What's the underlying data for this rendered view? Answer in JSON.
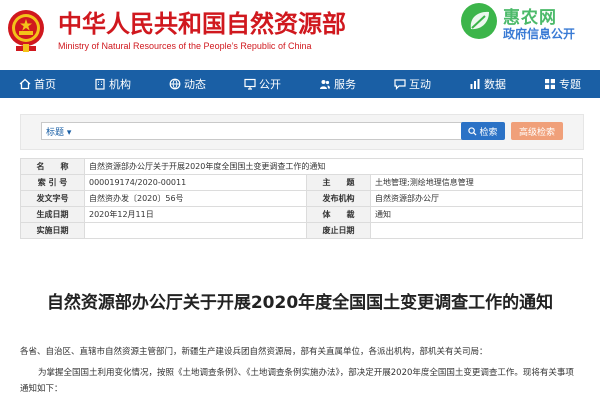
{
  "header": {
    "title": "中华人民共和国自然资源部",
    "subtitle": "Ministry of Natural Resources of the People’s Republic of China",
    "watermark_line1": "惠农网",
    "watermark_line2": "政府信息公开",
    "title_color": "#d0181e"
  },
  "nav": {
    "background": "#1a5fa5",
    "items": [
      {
        "label": "首页",
        "icon": "home-icon"
      },
      {
        "label": "机构",
        "icon": "building-icon"
      },
      {
        "label": "动态",
        "icon": "globe-icon"
      },
      {
        "label": "公开",
        "icon": "monitor-icon"
      },
      {
        "label": "服务",
        "icon": "people-icon"
      },
      {
        "label": "互动",
        "icon": "chat-icon"
      },
      {
        "label": "数据",
        "icon": "chart-icon"
      },
      {
        "label": "专题",
        "icon": "grid-icon"
      }
    ]
  },
  "search": {
    "select_label": "标题 ▾",
    "placeholder": "",
    "search_button": "检索",
    "advanced_button": "高级检索"
  },
  "info": {
    "rows": [
      {
        "l1": "名　　称",
        "v1": "自然资源部办公厅关于开展2020年度全国国土变更调查工作的通知",
        "l2": "",
        "v2": ""
      },
      {
        "l1": "索 引 号",
        "v1": "000019174/2020-00011",
        "l2": "主　　题",
        "v2": "土地管理;测绘地理信息管理"
      },
      {
        "l1": "发文字号",
        "v1": "自然资办发〔2020〕56号",
        "l2": "发布机构",
        "v2": "自然资源部办公厅"
      },
      {
        "l1": "生成日期",
        "v1": "2020年12月11日",
        "l2": "体　　裁",
        "v2": "通知"
      },
      {
        "l1": "实施日期",
        "v1": "",
        "l2": "废止日期",
        "v2": ""
      }
    ]
  },
  "article": {
    "title": "自然资源部办公厅关于开展2020年度全国国土变更调查工作的通知",
    "para1": "各省、自治区、直辖市自然资源主管部门，新疆生产建设兵团自然资源局，部有关直属单位，各派出机构，部机关有关司局：",
    "para2": "为掌握全国国土利用变化情况，按照《土地调查条例》、《土地调查条例实施办法》，部决定开展2020年度全国国土变更调查工作。现将有关事项通知如下："
  }
}
